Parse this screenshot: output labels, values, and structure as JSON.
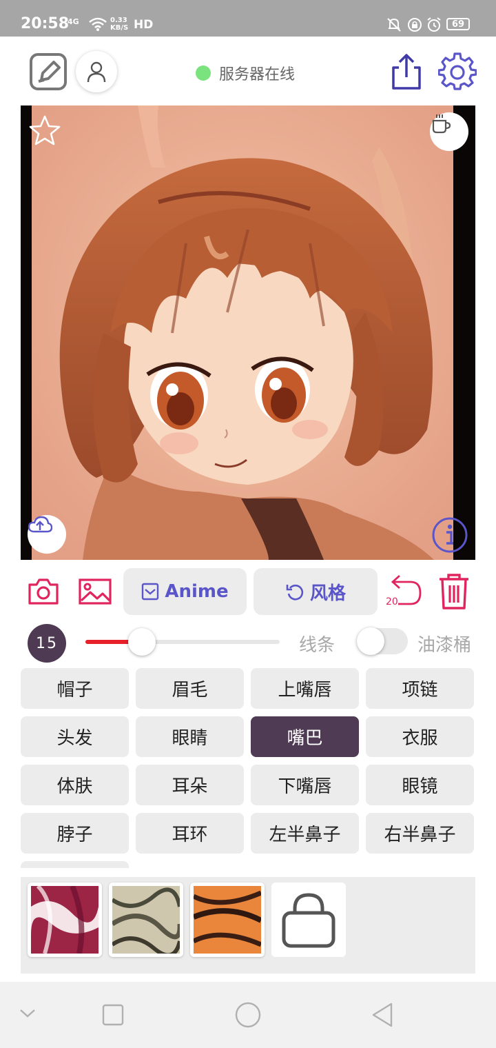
{
  "status_bar": {
    "time": "20:58",
    "network": "4G",
    "speed_value": "0.33",
    "speed_unit": "KB/S",
    "hd": "HD",
    "battery": "69"
  },
  "header": {
    "server_status": "服务器在线",
    "status_color": "#7ae37d"
  },
  "canvas": {
    "favorite_icon": "star-icon",
    "cup_icon": "coffee-cup-icon",
    "upload_icon": "cloud-upload-icon",
    "info_icon": "info-icon"
  },
  "toolbar": {
    "style_button": "Anime",
    "random_button": "风格",
    "undo_count": "20"
  },
  "brush": {
    "size": "15",
    "slider_level": 0.29,
    "line_label": "线条",
    "bucket_label": "油漆桶",
    "bucket_enabled": false
  },
  "parts": {
    "items": [
      "帽子",
      "眉毛",
      "上嘴唇",
      "项链",
      "头发",
      "眼睛",
      "嘴巴",
      "衣服",
      "体肤",
      "耳朵",
      "下嘴唇",
      "眼镜",
      "脖子",
      "耳环",
      "左半鼻子",
      "右半鼻子"
    ],
    "selected": "嘴巴"
  },
  "colors": {
    "accent": "#5a55c8",
    "danger": "#e0245e",
    "selected": "#4f3b53"
  }
}
